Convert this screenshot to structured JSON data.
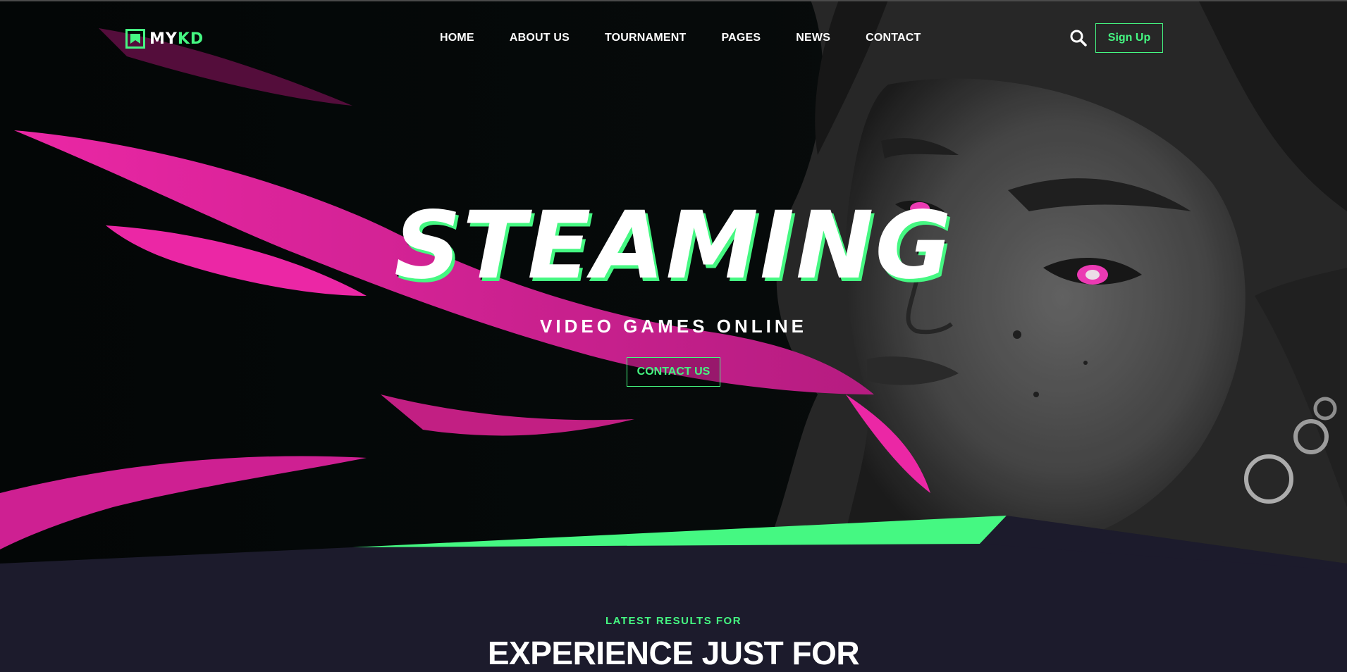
{
  "brand": {
    "logo_main": "MY",
    "logo_accent": "KD",
    "accent_color": "#45f882",
    "highlight_color": "#ff2bb3"
  },
  "nav": {
    "items": [
      {
        "label": "HOME"
      },
      {
        "label": "ABOUT US"
      },
      {
        "label": "TOURNAMENT"
      },
      {
        "label": "PAGES"
      },
      {
        "label": "NEWS"
      },
      {
        "label": "CONTACT"
      }
    ],
    "search_icon": "search-icon",
    "signup_label": "Sign Up"
  },
  "hero": {
    "title": "STEAMING",
    "subtitle": "VIDEO GAMES ONLINE",
    "cta_label": "CONTACT US"
  },
  "section": {
    "kicker": "LATEST RESULTS FOR",
    "title": "EXPERIENCE JUST FOR"
  }
}
